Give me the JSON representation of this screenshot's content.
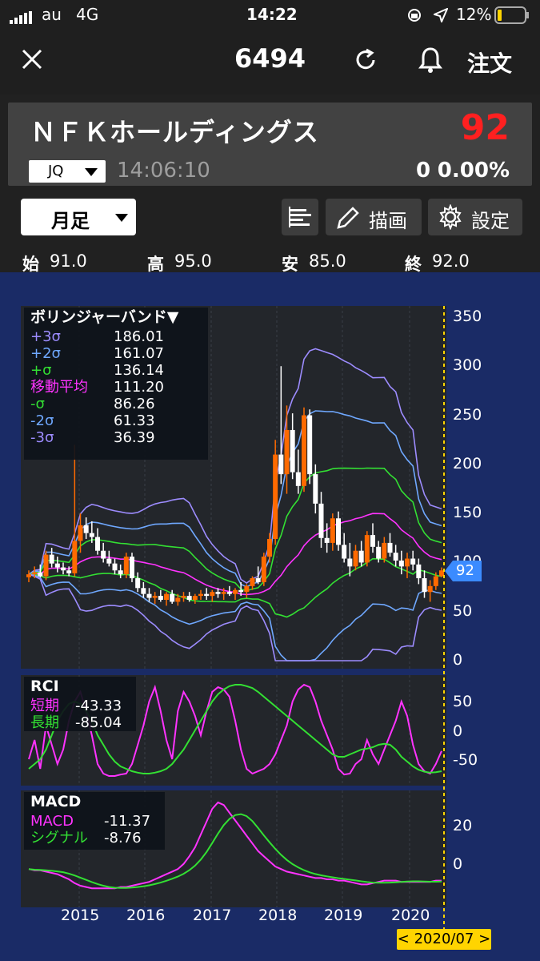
{
  "status_bar": {
    "carrier": "au",
    "network": "4G",
    "time": "14:22",
    "battery": "12%"
  },
  "nav": {
    "title": "6494",
    "order_label": "注文"
  },
  "stock": {
    "name": "ＮＦＫホールディングス",
    "price": "92",
    "market": "JQ",
    "time": "14:06:10",
    "change": "0",
    "change_pct": "0.00%",
    "price_color": "#ff2020"
  },
  "toolbar": {
    "period": "月足",
    "draw_label": "描画",
    "settings_label": "設定"
  },
  "ohlc": {
    "open_label": "始",
    "open": "91.0",
    "high_label": "高",
    "high": "95.0",
    "low_label": "安",
    "low": "85.0",
    "close_label": "終",
    "close": "92.0"
  },
  "bollinger": {
    "title": "ボリンジャーバンド▼",
    "rows": [
      {
        "label": "+3σ",
        "value": "186.01",
        "color": "#9d8cff"
      },
      {
        "label": "+2σ",
        "value": "161.07",
        "color": "#6fa8ff"
      },
      {
        "label": "+σ",
        "value": "136.14",
        "color": "#33e033"
      },
      {
        "label": "移動平均",
        "value": "111.20",
        "color": "#ff33ff"
      },
      {
        "label": "-σ",
        "value": "86.26",
        "color": "#33e033"
      },
      {
        "label": "-2σ",
        "value": "61.33",
        "color": "#6fa8ff"
      },
      {
        "label": "-3σ",
        "value": "36.39",
        "color": "#9d8cff"
      }
    ],
    "y_ticks": [
      "350",
      "300",
      "250",
      "200",
      "150",
      "100",
      "50",
      "0"
    ],
    "price_tag": "92"
  },
  "rci": {
    "title": "RCI",
    "rows": [
      {
        "label": "短期",
        "value": "-43.33",
        "color": "#ff33ff"
      },
      {
        "label": "長期",
        "value": "-85.04",
        "color": "#33e033"
      }
    ],
    "y_ticks": [
      "50",
      "0",
      "-50"
    ]
  },
  "macd": {
    "title": "MACD",
    "rows": [
      {
        "label": "MACD",
        "value": "-11.37",
        "color": "#ff33ff"
      },
      {
        "label": "シグナル",
        "value": "-8.76",
        "color": "#33e033"
      }
    ],
    "y_ticks": [
      "20",
      "0"
    ]
  },
  "x_axis": {
    "labels": [
      "2015",
      "2016",
      "2017",
      "2018",
      "2019",
      "2020"
    ],
    "cursor_label": "< 2020/07 >"
  },
  "colors": {
    "up": "#ff6a00",
    "down": "#ffffff",
    "bg": "#1a2b66",
    "panel": "#23262b",
    "cursor": "#ffd400"
  },
  "chart_data": {
    "type": "candlestick",
    "x_labels": [
      "2015",
      "2016",
      "2017",
      "2018",
      "2019",
      "2020"
    ],
    "current": {
      "date": "2020/07",
      "open": 91.0,
      "high": 95.0,
      "low": 85.0,
      "close": 92.0
    },
    "ylim": [
      0,
      350
    ],
    "candles": [
      [
        85,
        92,
        80,
        88
      ],
      [
        88,
        96,
        84,
        90
      ],
      [
        90,
        98,
        85,
        86
      ],
      [
        86,
        112,
        82,
        108
      ],
      [
        108,
        115,
        95,
        99
      ],
      [
        99,
        106,
        90,
        95
      ],
      [
        95,
        100,
        88,
        92
      ],
      [
        92,
        96,
        86,
        89
      ],
      [
        89,
        220,
        86,
        122
      ],
      [
        122,
        150,
        110,
        138
      ],
      [
        138,
        146,
        124,
        130
      ],
      [
        130,
        142,
        120,
        126
      ],
      [
        126,
        135,
        108,
        112
      ],
      [
        112,
        120,
        100,
        104
      ],
      [
        104,
        112,
        96,
        99
      ],
      [
        99,
        104,
        88,
        92
      ],
      [
        92,
        98,
        84,
        88
      ],
      [
        88,
        110,
        84,
        106
      ],
      [
        106,
        110,
        80,
        84
      ],
      [
        84,
        90,
        70,
        74
      ],
      [
        74,
        80,
        64,
        68
      ],
      [
        68,
        74,
        60,
        64
      ],
      [
        64,
        70,
        58,
        66
      ],
      [
        66,
        72,
        60,
        62
      ],
      [
        62,
        70,
        56,
        68
      ],
      [
        68,
        72,
        58,
        60
      ],
      [
        60,
        68,
        56,
        64
      ],
      [
        64,
        70,
        60,
        66
      ],
      [
        66,
        70,
        60,
        62
      ],
      [
        62,
        68,
        58,
        66
      ],
      [
        66,
        72,
        62,
        68
      ],
      [
        68,
        74,
        62,
        66
      ],
      [
        66,
        72,
        60,
        70
      ],
      [
        70,
        74,
        64,
        68
      ],
      [
        68,
        74,
        62,
        70
      ],
      [
        70,
        76,
        66,
        68
      ],
      [
        68,
        74,
        62,
        72
      ],
      [
        72,
        80,
        66,
        70
      ],
      [
        70,
        78,
        64,
        76
      ],
      [
        76,
        86,
        72,
        84
      ],
      [
        84,
        96,
        78,
        80
      ],
      [
        80,
        110,
        76,
        106
      ],
      [
        106,
        130,
        100,
        124
      ],
      [
        124,
        225,
        118,
        210
      ],
      [
        210,
        300,
        180,
        190
      ],
      [
        190,
        260,
        170,
        235
      ],
      [
        235,
        252,
        185,
        192
      ],
      [
        192,
        215,
        170,
        178
      ],
      [
        178,
        258,
        172,
        250
      ],
      [
        250,
        256,
        180,
        190
      ],
      [
        190,
        200,
        150,
        160
      ],
      [
        160,
        172,
        115,
        125
      ],
      [
        125,
        140,
        110,
        120
      ],
      [
        120,
        150,
        112,
        145
      ],
      [
        145,
        152,
        112,
        118
      ],
      [
        118,
        130,
        100,
        104
      ],
      [
        104,
        120,
        86,
        96
      ],
      [
        96,
        118,
        92,
        112
      ],
      [
        112,
        122,
        96,
        100
      ],
      [
        100,
        132,
        96,
        128
      ],
      [
        128,
        140,
        110,
        116
      ],
      [
        116,
        122,
        100,
        104
      ],
      [
        104,
        126,
        100,
        120
      ],
      [
        120,
        130,
        106,
        110
      ],
      [
        110,
        118,
        96,
        102
      ],
      [
        102,
        112,
        88,
        96
      ],
      [
        96,
        110,
        84,
        104
      ],
      [
        104,
        112,
        92,
        98
      ],
      [
        98,
        104,
        78,
        84
      ],
      [
        84,
        92,
        64,
        70
      ],
      [
        70,
        82,
        60,
        76
      ],
      [
        76,
        90,
        72,
        86
      ],
      [
        86,
        95,
        85,
        92
      ]
    ]
  }
}
